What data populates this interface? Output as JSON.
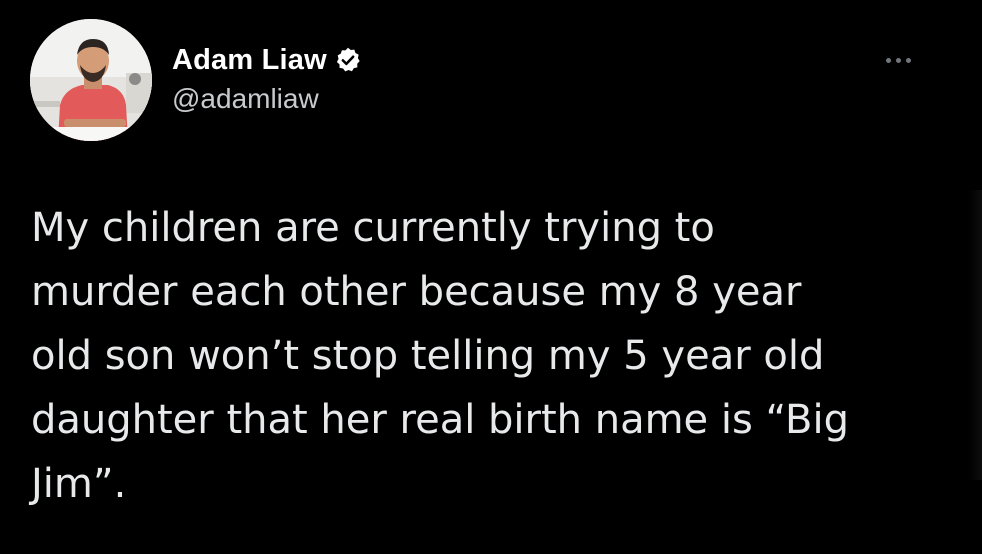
{
  "tweet": {
    "author": {
      "display_name": "Adam Liaw",
      "handle": "@adamliaw",
      "verified_icon": "verified-badge-icon",
      "avatar_icon": "profile-photo"
    },
    "more_icon": "more-options-icon",
    "text": "My children are currently trying to\nmurder each other because my 8 year\nold son won’t stop telling my 5 year old\ndaughter that her real birth name is “Big\nJim”."
  },
  "colors": {
    "background": "#000000",
    "name": "#ffffff",
    "handle": "#c8cbce",
    "body_text": "#e7e9ea",
    "muted": "#71767b"
  }
}
